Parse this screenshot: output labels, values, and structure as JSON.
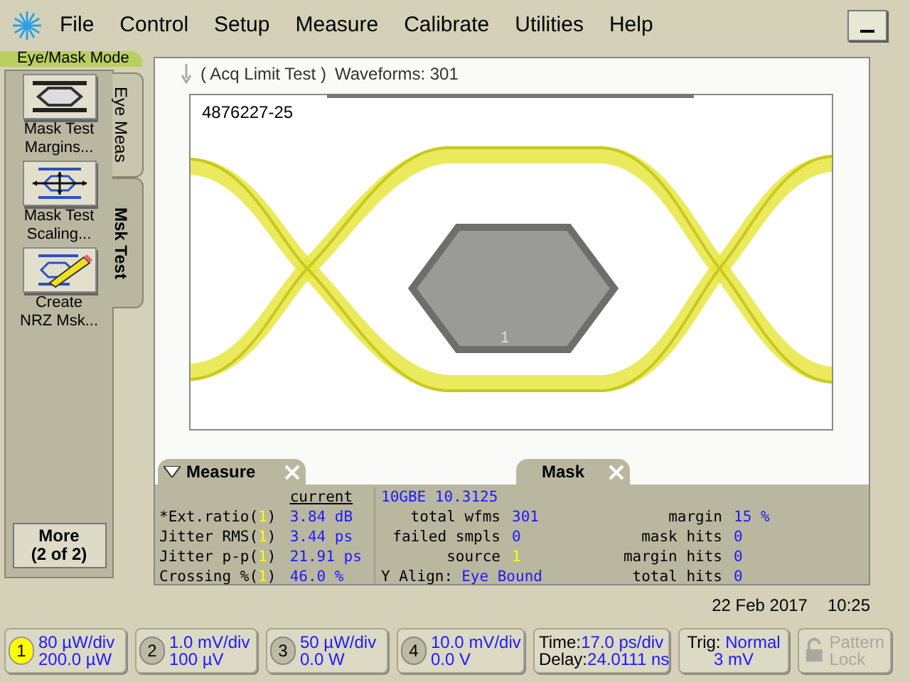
{
  "menu": [
    "File",
    "Control",
    "Setup",
    "Measure",
    "Calibrate",
    "Utilities",
    "Help"
  ],
  "mode_label": "Eye/Mask Mode",
  "tabs": [
    {
      "label": "Eye Meas",
      "selected": false
    },
    {
      "label": "Msk Test",
      "selected": true
    }
  ],
  "tool_buttons": [
    {
      "kind": "margins",
      "lines": [
        "Mask Test",
        "Margins..."
      ]
    },
    {
      "kind": "scaling",
      "lines": [
        "Mask Test",
        "Scaling..."
      ]
    },
    {
      "kind": "create",
      "lines": [
        "Create",
        "NRZ Msk..."
      ]
    }
  ],
  "more_button": [
    "More",
    "(2 of 2)"
  ],
  "screen": {
    "status": "( Acq Limit Test )",
    "waveforms": "Waveforms: 301",
    "graticule_label": "4876227-25",
    "mask_number": "1"
  },
  "measure": {
    "title": "Measure",
    "header": "current",
    "rows": [
      {
        "name": "*Ext.ratio(",
        "source": "1",
        "close": ")",
        "value": "3.84 dB"
      },
      {
        "name": "Jitter RMS(",
        "source": "1",
        "close": ")",
        "value": "3.44 ps"
      },
      {
        "name": "Jitter p-p(",
        "source": "1",
        "close": ")",
        "value": "21.91 ps"
      },
      {
        "name": "Crossing %(",
        "source": "1",
        "close": ")",
        "value": "46.0 %"
      }
    ]
  },
  "mask": {
    "title": "Mask",
    "standard": "10GBE 10.3125",
    "left": [
      {
        "label": "total wfms",
        "value": "301",
        "kind": "plain"
      },
      {
        "label": "failed smpls",
        "value": "0",
        "kind": "plain"
      },
      {
        "label": "source",
        "value": "1",
        "kind": "source"
      }
    ],
    "align": {
      "label": "Y Align:",
      "value": "Eye Bound"
    },
    "right": [
      {
        "label": "margin",
        "value": "15 %"
      },
      {
        "label": "mask hits",
        "value": "0"
      },
      {
        "label": "margin hits",
        "value": "0"
      },
      {
        "label": "total hits",
        "value": "0"
      }
    ]
  },
  "date": "22 Feb 2017",
  "time": "10:25",
  "channels": [
    {
      "number": "1",
      "scale": "80 µW/div",
      "offset": "200.0 µW",
      "selected": true
    },
    {
      "number": "2",
      "scale": "1.0 mV/div",
      "offset": "100 µV",
      "selected": false
    },
    {
      "number": "3",
      "scale": "50 µW/div",
      "offset": "0.0 W",
      "selected": false
    },
    {
      "number": "4",
      "scale": "10.0 mV/div",
      "offset": "0.0 V",
      "selected": false
    }
  ],
  "timebase": {
    "time_label": "Time:",
    "time": "17.0 ps/div",
    "delay_label": "Delay:",
    "delay": "24.0111 ns"
  },
  "trigger": {
    "label": "Trig:",
    "mode": "Normal",
    "level": "3 mV"
  },
  "pattern_lock": {
    "lines": [
      "Pattern",
      "Lock"
    ],
    "disabled": true
  }
}
